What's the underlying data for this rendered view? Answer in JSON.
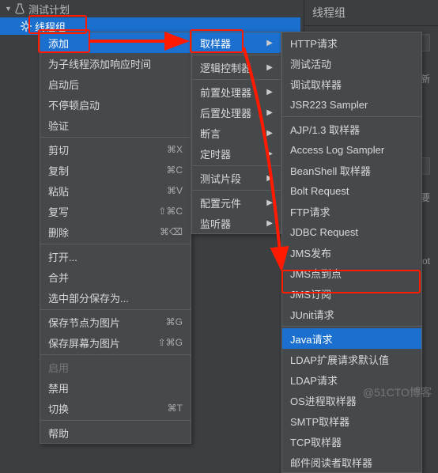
{
  "tree": {
    "root": "测试计划",
    "child": "线程组"
  },
  "panel": {
    "title": "线程组",
    "hint_row1": "行的新",
    "hint_row2": ":",
    "hint_row3": "需要",
    "hint_row4": "not"
  },
  "menu1": {
    "add": "添加",
    "add_think": "为子线程添加响应时间",
    "start": "启动后",
    "nonstop_start": "不停顿启动",
    "verify": "验证",
    "cut": "剪切",
    "cut_k": "⌘X",
    "copy": "复制",
    "copy_k": "⌘C",
    "paste": "粘贴",
    "paste_k": "⌘V",
    "dup": "复写",
    "dup_k": "⇧⌘C",
    "delete": "删除",
    "delete_k": "⌘⌫",
    "open": "打开...",
    "merge": "合并",
    "save_sel": "选中部分保存为...",
    "save_node_img": "保存节点为图片",
    "save_node_img_k": "⌘G",
    "save_screen_img": "保存屏幕为图片",
    "save_screen_img_k": "⇧⌘G",
    "enable": "启用",
    "disable": "禁用",
    "toggle": "切换",
    "toggle_k": "⌘T",
    "help": "帮助"
  },
  "menu2": {
    "sampler": "取样器",
    "logic": "逻辑控制器",
    "pre": "前置处理器",
    "post": "后置处理器",
    "assert": "断言",
    "timer": "定时器",
    "frag": "测试片段",
    "config": "配置元件",
    "listener": "监听器"
  },
  "menu3": {
    "items": [
      "HTTP请求",
      "测试活动",
      "调试取样器",
      "JSR223 Sampler",
      "AJP/1.3 取样器",
      "Access Log Sampler",
      "BeanShell 取样器",
      "Bolt Request",
      "FTP请求",
      "JDBC Request",
      "JMS发布",
      "JMS点到点",
      "JMS订阅",
      "JUnit请求",
      "Java请求",
      "LDAP扩展请求默认值",
      "LDAP请求",
      "OS进程取样器",
      "SMTP取样器",
      "TCP取样器",
      "邮件阅读者取样器"
    ],
    "selected_index": 14
  },
  "watermark": "@51CTO博客"
}
